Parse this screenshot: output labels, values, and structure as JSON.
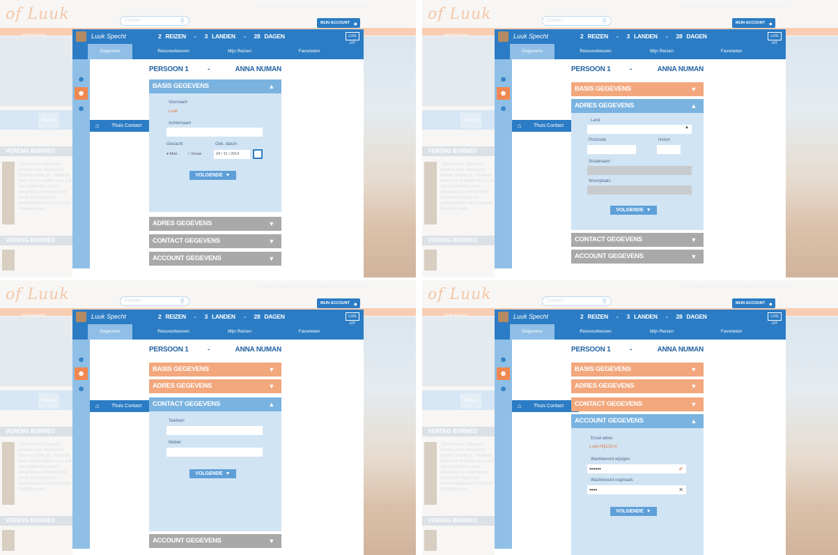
{
  "site": {
    "logo": "of Luuk",
    "search_placeholder": "Zoeken",
    "top_links": "SLAAPKAMERS   ZOEK BESTEMMINGEN   CONTACT",
    "nav_item": "RONDREIZEN",
    "bg_tab": "Reizen",
    "bg_title_1": "VERENG BORNEO",
    "bg_title_2": "VERENG BORNEO",
    "bg_text": "Tijdens deze 12daagse rondreis door Maleisisch Borneo ontdek je... Maleisië heeft veel te bieden en u zult niet uitgekeken raken... activiteiten te ondernemen om te bezichtigen en... verleidt tijdens deze rondreis Kinabalu waar...",
    "account_label": "MIJN ACCOUNT"
  },
  "header": {
    "user_name": "Luuk Specht",
    "stats": "2 REIZEN  -  3 LANDEN  -  28 DAGEN",
    "logout": "LOG UIT"
  },
  "tabs": [
    "Gegevens",
    "Reisvoorkeuren",
    "Mijn Reizen",
    "Favorieten"
  ],
  "sidebar": {
    "thuis_contact": "Thuis Contact"
  },
  "person": {
    "label": "PERSOON 1",
    "dash": "-",
    "name": "ANNA NUMAN"
  },
  "sections": {
    "basis": "BASIS GEGEVENS",
    "adres": "ADRES GEGEVENS",
    "contact": "CONTACT GEGEVENS",
    "account": "ACCOUNT GEGEVENS"
  },
  "basis_form": {
    "voornaam_label": "Voornaam",
    "voornaam_value": "Luuk",
    "achternaam_label": "Achternaam",
    "geslacht_label": "Geslacht",
    "geb_label": "Geb. datum",
    "man": "Man",
    "vrouw": "Vrouw",
    "date": "24 / 11 / 2014"
  },
  "adres_form": {
    "land": "Land",
    "postcode": "Postcode",
    "huisnr": "Huisnr",
    "straatnaam": "Straatnaam",
    "woonplaats": "Woonplaats"
  },
  "contact_form": {
    "telefoon": "Telefoon",
    "mobiel": "Mobiel"
  },
  "account_form": {
    "email_label": "Email adres",
    "email_value": "Luuk-Hiji123.nl",
    "pw_label": "Wachtwoord wijzigen",
    "pw_value": "••••••",
    "pw2_label": "Wachtwoord nogmaals",
    "pw2_value": "••••"
  },
  "next_button": "VOLGENDE"
}
